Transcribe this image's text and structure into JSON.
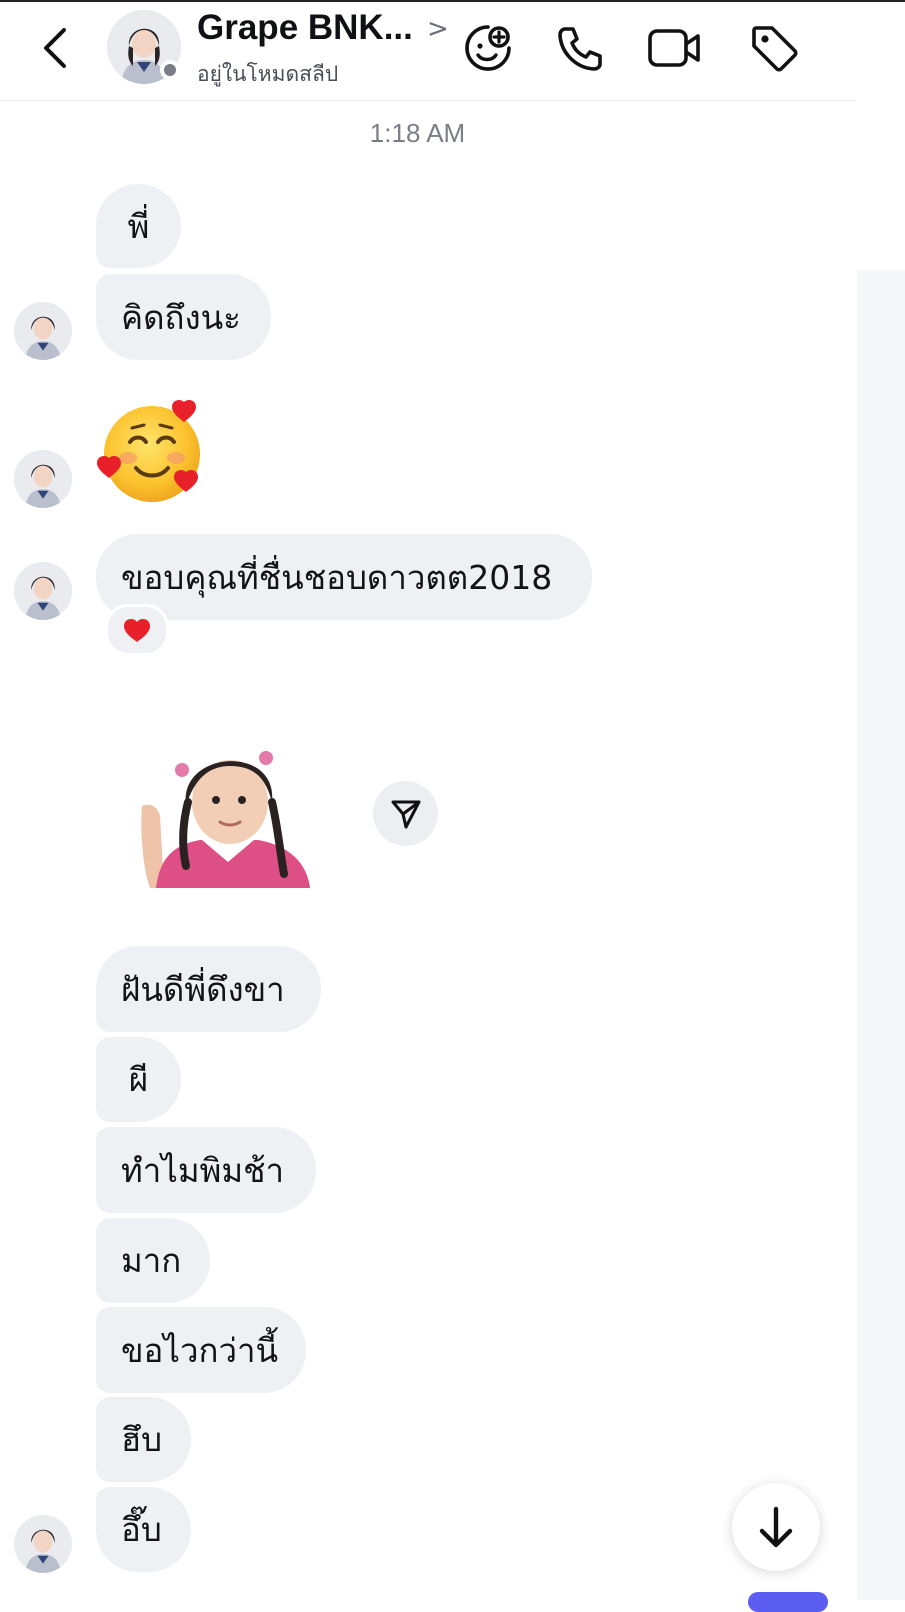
{
  "header": {
    "contact_name": "Grape BNK...",
    "chevron": ">",
    "status": "อยู่ในโหมดสลีป",
    "icons": [
      "back-chevron-icon",
      "add-game-icon",
      "phone-call-icon",
      "video-call-icon",
      "tag-icon"
    ]
  },
  "conversation": {
    "timestamp": "1:18 AM",
    "messages": [
      {
        "text": "พี่"
      },
      {
        "text": "คิดถึงนะ"
      },
      {
        "emoji": "smiling-face-with-hearts"
      },
      {
        "text": "ขอบคุณที่ชื่นชอบดาวตต2018"
      },
      {
        "reaction": "heart"
      },
      {
        "sticker": "girl-sticker"
      },
      {
        "text": "ฝันดีพี่ดึงขา"
      },
      {
        "text": "ผี"
      },
      {
        "text": "ทำไมพิมช้า"
      },
      {
        "text": "มาก"
      },
      {
        "text": "ขอไวกว่านี้"
      },
      {
        "text": "ฮึบ"
      },
      {
        "text": "อึ๊บ"
      }
    ]
  },
  "controls": {
    "share_icon": "send-arrow-icon",
    "scroll_icon": "arrow-down-icon"
  },
  "colors": {
    "bubble": "#eef0f4",
    "accent": "#5b5cf0"
  }
}
